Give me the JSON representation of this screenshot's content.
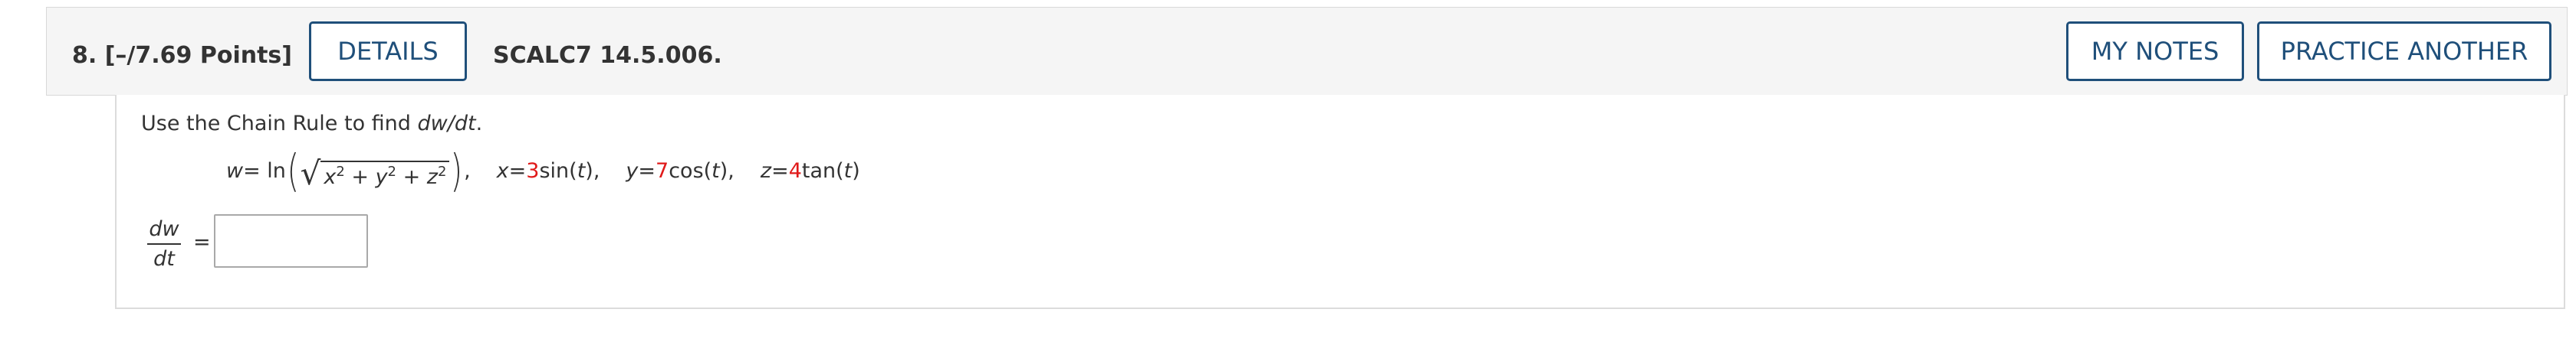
{
  "question": {
    "number_points": "8.  [–/7.69 Points]",
    "code": "SCALC7 14.5.006.",
    "buttons": {
      "details": "DETAILS",
      "my_notes": "MY NOTES",
      "practice_another": "PRACTICE ANOTHER"
    }
  },
  "body": {
    "instruction_prefix": "Use the Chain Rule to find ",
    "instruction_var": "dw/dt",
    "instruction_suffix": ".",
    "equation": {
      "w_lhs": "w",
      "w_eq": " = ln",
      "radicand_x": "x",
      "radicand_y": "y",
      "radicand_z": "z",
      "plus": " + ",
      "exp": "2",
      "comma": ",",
      "x_var": "x",
      "x_eq": " = ",
      "x_coef": "3",
      "x_fn": " sin(",
      "t": "t",
      "close": "),",
      "y_var": "y",
      "y_eq": " = ",
      "y_coef": "7",
      "y_fn": " cos(",
      "z_var": "z",
      "z_eq": " = ",
      "z_coef": "4",
      "z_fn": " tan(",
      "close_last": ")"
    },
    "answer": {
      "numerator": "dw",
      "denominator": "dt",
      "equals": "=",
      "value": ""
    }
  },
  "colors": {
    "accent": "#1f4f7a",
    "highlight": "#e01a1a",
    "header_bg": "#f5f5f5"
  }
}
